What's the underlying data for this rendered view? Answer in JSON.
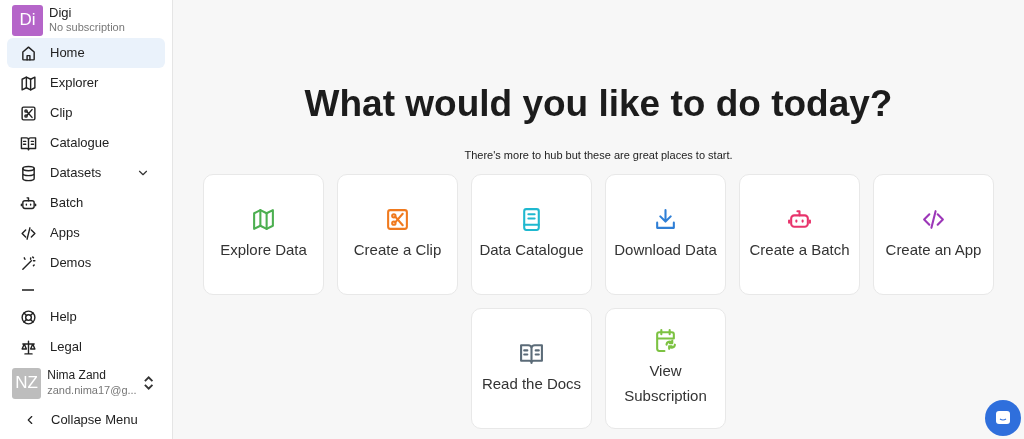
{
  "organization": {
    "initials": "Di",
    "name": "Digi",
    "plan": "No subscription"
  },
  "sidebar": {
    "items": [
      {
        "label": "Home",
        "selected": true,
        "kind": "link"
      },
      {
        "label": "Explorer",
        "selected": false,
        "kind": "link"
      },
      {
        "label": "Clip",
        "selected": false,
        "kind": "link"
      },
      {
        "label": "Catalogue",
        "selected": false,
        "kind": "link"
      },
      {
        "label": "Datasets",
        "selected": false,
        "kind": "group",
        "expanded": false
      },
      {
        "label": "Batch",
        "selected": false,
        "kind": "link"
      },
      {
        "label": "Apps",
        "selected": false,
        "kind": "link"
      },
      {
        "label": "Demos",
        "selected": false,
        "kind": "link"
      }
    ],
    "footer_items": [
      {
        "label": "Help",
        "selected": false
      },
      {
        "label": "Legal",
        "selected": false
      }
    ],
    "user": {
      "initials": "NZ",
      "name": "Nima Zand",
      "email": "zand.nima17@g..."
    },
    "collapse": "Collapse Menu"
  },
  "main": {
    "title": "What would you like to do today?",
    "subtitle": "There's more to hub but these are great places to start.",
    "cards": [
      {
        "label": "Explore Data"
      },
      {
        "label": "Create a Clip"
      },
      {
        "label": "Data Catalogue"
      },
      {
        "label": "Download Data"
      },
      {
        "label": "Create a Batch"
      },
      {
        "label": "Create an App"
      },
      {
        "label": "Read the Docs"
      },
      {
        "label": "View Subscription"
      }
    ]
  }
}
